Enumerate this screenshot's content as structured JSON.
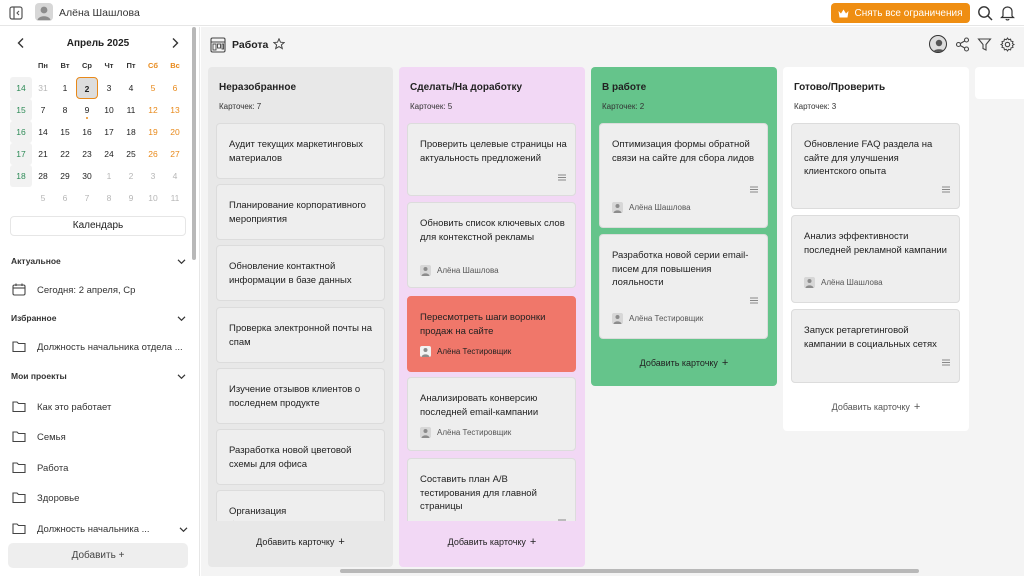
{
  "topbar": {
    "user_name": "Алёна Шашлова",
    "remove_limits_label": "Снять все ограничения",
    "accent": "#ef8e12"
  },
  "calendar": {
    "month_label": "Апрель 2025",
    "weekdays": [
      "Пн",
      "Вт",
      "Ср",
      "Чт",
      "Пт",
      "Сб",
      "Вс"
    ],
    "weeks": [
      {
        "week": "14",
        "days": [
          "31",
          "1",
          "2",
          "3",
          "4",
          "5",
          "6"
        ]
      },
      {
        "week": "15",
        "days": [
          "7",
          "8",
          "9",
          "10",
          "11",
          "12",
          "13"
        ]
      },
      {
        "week": "16",
        "days": [
          "14",
          "15",
          "16",
          "17",
          "18",
          "19",
          "20"
        ]
      },
      {
        "week": "17",
        "days": [
          "21",
          "22",
          "23",
          "24",
          "25",
          "26",
          "27"
        ]
      },
      {
        "week": "18",
        "days": [
          "28",
          "29",
          "30",
          "1",
          "2",
          "3",
          "4"
        ]
      },
      {
        "week": "",
        "days": [
          "5",
          "6",
          "7",
          "8",
          "9",
          "10",
          "11"
        ]
      }
    ],
    "today": "2",
    "button_label": "Календарь"
  },
  "sidebar": {
    "sections": {
      "actual": {
        "title": "Актуальное",
        "items": [
          {
            "label": "Сегодня: 2 апреля, Ср",
            "icon": "calendar-icon"
          }
        ]
      },
      "favorites": {
        "title": "Избранное",
        "items": [
          {
            "label": "Должность начальника отдела ...",
            "icon": "folder-icon"
          }
        ]
      },
      "projects": {
        "title": "Мои проекты",
        "items": [
          {
            "label": "Как это работает",
            "icon": "folder-icon"
          },
          {
            "label": "Семья",
            "icon": "folder-icon"
          },
          {
            "label": "Работа",
            "icon": "folder-icon"
          },
          {
            "label": "Здоровье",
            "icon": "folder-icon"
          },
          {
            "label": "Должность начальника ...",
            "icon": "folder-icon"
          }
        ]
      }
    },
    "add_label": "Добавить +"
  },
  "board": {
    "title": "Работа",
    "add_card_label": "Добавить карточку",
    "columns": [
      {
        "title": "Неразобранное",
        "count_label": "Карточек: 7",
        "color": "#e8e8e8",
        "cards": [
          {
            "title": "Аудит текущих маркетинговых материалов"
          },
          {
            "title": "Планирование корпоративного мероприятия"
          },
          {
            "title": "Обновление контактной информации в базе данных"
          },
          {
            "title": "Проверка электронной почты на спам"
          },
          {
            "title": "Изучение отзывов клиентов о последнем продукте"
          },
          {
            "title": "Разработка новой цветовой схемы для офиса"
          },
          {
            "title": "Организация благотворительного марафона"
          }
        ]
      },
      {
        "title": "Сделать/На доработку",
        "count_label": "Карточек: 5",
        "color": "#f2d8f5",
        "cards": [
          {
            "title": "Проверить целевые страницы на актуальность предложений"
          },
          {
            "title": "Обновить список ключевых слов для контекстной рекламы",
            "user": "Алёна Шашлова"
          },
          {
            "title": "Пересмотреть шаги воронки продаж на сайте",
            "user": "Алёна Тестировщик",
            "highlight": "#f0776a"
          },
          {
            "title": "Анализировать конверсию последней email-кампании",
            "user": "Алёна Тестировщик"
          },
          {
            "title": "Составить план A/B тестирования для главной страницы"
          }
        ]
      },
      {
        "title": "В работе",
        "count_label": "Карточек: 2",
        "color": "#65c48b",
        "cards": [
          {
            "title": "Оптимизация формы обратной связи на сайте для сбора лидов",
            "user": "Алёна Шашлова"
          },
          {
            "title": "Разработка новой серии email-писем для повышения лояльности",
            "user": "Алёна Тестировщик"
          }
        ]
      },
      {
        "title": "Готово/Проверить",
        "count_label": "Карточек: 3",
        "color": "#ffffff",
        "cards": [
          {
            "title": "Обновление FAQ раздела на сайте для улучшения клиентского опыта"
          },
          {
            "title": "Анализ эффективности последней рекламной кампании",
            "user": "Алёна Шашлова"
          },
          {
            "title": "Запуск ретаргетинговой кампании в социальных сетях"
          }
        ]
      }
    ]
  }
}
